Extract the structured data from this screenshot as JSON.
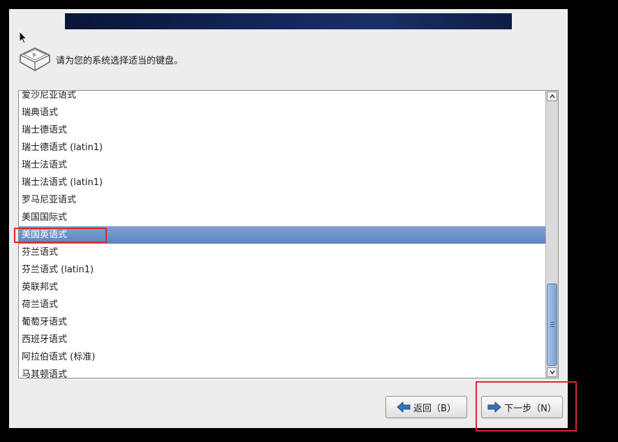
{
  "header": {
    "prompt": "请为您的系统选择适当的键盘。",
    "icon": "keyboard-key-icon"
  },
  "keyboard_list": {
    "selected_index": 8,
    "items": [
      "爱沙尼亚语式",
      "瑞典语式",
      "瑞士德语式",
      "瑞士德语式 (latin1)",
      "瑞士法语式",
      "瑞士法语式 (latin1)",
      "罗马尼亚语式",
      "美国国际式",
      "美国英语式",
      "芬兰语式",
      "芬兰语式 (latin1)",
      "英联邦式",
      "荷兰语式",
      "葡萄牙语式",
      "西班牙语式",
      "阿拉伯语式 (标准)",
      "马其顿语式"
    ]
  },
  "buttons": {
    "back_label": "返回（B）",
    "next_label": "下一步（N）"
  },
  "colors": {
    "selection": "#5c86c0",
    "annotation": "#e0262b",
    "arrow": "#3a6fb8"
  }
}
